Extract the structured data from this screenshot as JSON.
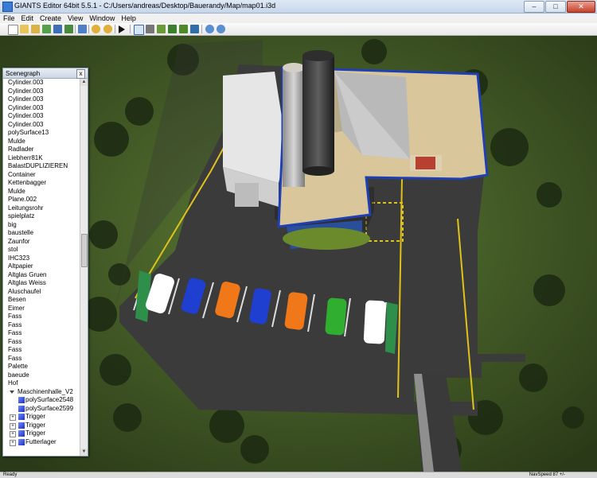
{
  "window": {
    "title": "GIANTS Editor 64bit 5.5.1 - C:/Users/andreas/Desktop/Bauerandy/Map/map01.i3d",
    "minimize": "–",
    "maximize": "□",
    "close": "✕"
  },
  "menu": [
    "File",
    "Edit",
    "Create",
    "View",
    "Window",
    "Help"
  ],
  "toolbar": {
    "icons": [
      "new-file-icon",
      "open-file-icon",
      "open-recent-icon",
      "reload-icon",
      "save-icon",
      "save-as-icon",
      "export-icon",
      "undo-icon",
      "redo-icon",
      "play-icon",
      "select-icon",
      "magnet-icon",
      "terrain-sculpt-icon",
      "terrain-paint-icon",
      "foliage-paint-icon",
      "object-place-icon",
      "settings-icon",
      "grid-icon"
    ]
  },
  "scenegraph": {
    "title": "Scenegraph",
    "close": "x",
    "items": [
      {
        "label": "Cylinder.003"
      },
      {
        "label": "Cylinder.003"
      },
      {
        "label": "Cylinder.003"
      },
      {
        "label": "Cylinder.003"
      },
      {
        "label": "Cylinder.003"
      },
      {
        "label": "Cylinder.003"
      },
      {
        "label": "polySurface13"
      },
      {
        "label": "Mulde"
      },
      {
        "label": "Radlader"
      },
      {
        "label": "Liebherr81K"
      },
      {
        "label": "BalastDUPLIZIEREN"
      },
      {
        "label": "Container"
      },
      {
        "label": "Kettenbagger"
      },
      {
        "label": "Mulde"
      },
      {
        "label": "Plane.002"
      },
      {
        "label": "Leitungsrohr"
      },
      {
        "label": "spielplatz"
      },
      {
        "label": "big"
      },
      {
        "label": "baustelle"
      },
      {
        "label": "Zaunfor"
      },
      {
        "label": "stol"
      },
      {
        "label": "IHC323"
      },
      {
        "label": "Altpapier"
      },
      {
        "label": "Altglas Gruen"
      },
      {
        "label": "Altglas Weiss"
      },
      {
        "label": "Aluschaufel"
      },
      {
        "label": "Besen"
      },
      {
        "label": "Eimer"
      },
      {
        "label": "Fass"
      },
      {
        "label": "Fass"
      },
      {
        "label": "Fass"
      },
      {
        "label": "Fass"
      },
      {
        "label": "Fass"
      },
      {
        "label": "Fass"
      },
      {
        "label": "Palette"
      },
      {
        "label": "baeude"
      },
      {
        "label": "Hof"
      },
      {
        "label": "Maschinenhalle_V2",
        "type": "expanded"
      },
      {
        "label": "polySurface2548",
        "type": "child"
      },
      {
        "label": "polySurface2599",
        "type": "child"
      },
      {
        "label": "Trigger",
        "type": "child-exp"
      },
      {
        "label": "Trigger",
        "type": "child-exp"
      },
      {
        "label": "Trigger",
        "type": "child-exp"
      },
      {
        "label": "Futterlager",
        "type": "child-exp"
      }
    ]
  },
  "status": {
    "left": "Ready",
    "right": "NavSpeed 87 +/-"
  },
  "colors": {
    "asphalt": "#3a3a3a",
    "grass": "#4f6a2e",
    "roof": "#d9c79b",
    "roof_trim": "#1f3fb4",
    "line_yellow": "#e0c21a",
    "car_white": "#ffffff",
    "car_blue": "#1e3fd0",
    "car_orange": "#f07818",
    "car_green": "#2fae2f"
  }
}
